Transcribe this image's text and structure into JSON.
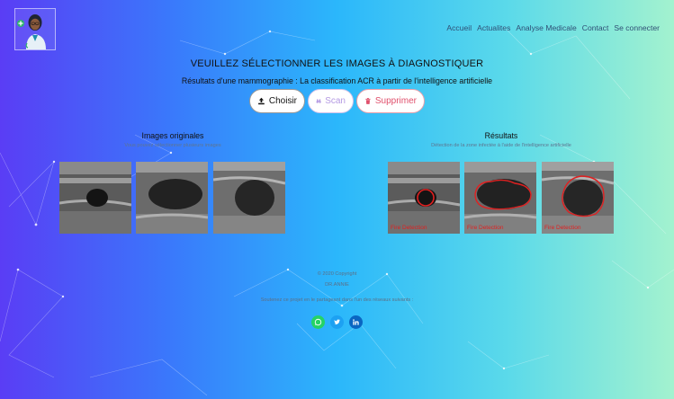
{
  "nav": {
    "items": [
      "Accueil",
      "Actualites",
      "Analyse Medicale",
      "Contact",
      "Se connecter"
    ]
  },
  "main": {
    "title": "VEUILLEZ SÉLECTIONNER LES IMAGES À DIAGNOSTIQUER",
    "subtitle": "Résultats d'une mammographie : La classification ACR à partir de l'intelligence artificielle"
  },
  "actions": {
    "choose_label": "Choisir",
    "scan_label": "Scan",
    "delete_label": "Supprimer"
  },
  "originals": {
    "heading": "Images originales",
    "caption": "Vous pouvez sélectionner plusieurs images"
  },
  "results": {
    "heading": "Résultats",
    "caption": "Détection de la zone infectée à l'aide de l'intelligence artificielle",
    "detection_label": "Fire Detection"
  },
  "footer": {
    "copyright": "© 2020 Copyright",
    "brand": "DR.ANNIE",
    "share_text": "Soutenez ce projet en le partageant dans l'un des réseaux suivants :"
  },
  "colors": {
    "whatsapp": "#25d366",
    "twitter": "#1da1f2",
    "linkedin": "#0a66c2",
    "detection": "#e02020"
  }
}
